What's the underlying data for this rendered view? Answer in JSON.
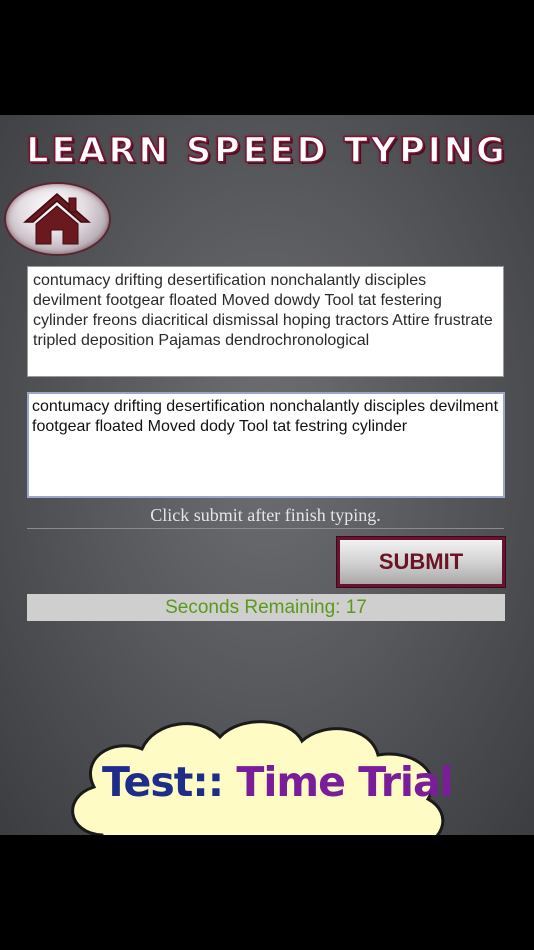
{
  "header": {
    "title": "LEARN SPEED TYPING"
  },
  "passage": {
    "text": " contumacy drifting desertification nonchalantly disciples devilment footgear floated Moved dowdy Tool tat festering cylinder freons diacritical dismissal hoping tractors Attire frustrate tripled deposition Pajamas dendrochronological"
  },
  "typing": {
    "value": "contumacy drifting desertification nonchalantly disciples devilment footgear floated Moved dody Tool tat festring cylinder"
  },
  "hint": {
    "text": "Click submit after finish typing."
  },
  "submit": {
    "label": "SUBMIT"
  },
  "timer": {
    "text": "Seconds Remaining: 17"
  },
  "banner": {
    "prefix": "Test:: ",
    "mode": "Time Trial"
  },
  "colors": {
    "title_stroke": "#7a1430",
    "house_icon": "#6a1a1f",
    "timer_text": "#5a9a1a",
    "cloud_fill": "#fffbc4",
    "banner_prefix": "#1e2d8a",
    "banner_mode": "#7a1d9a"
  },
  "icons": {
    "home": "home-icon"
  }
}
